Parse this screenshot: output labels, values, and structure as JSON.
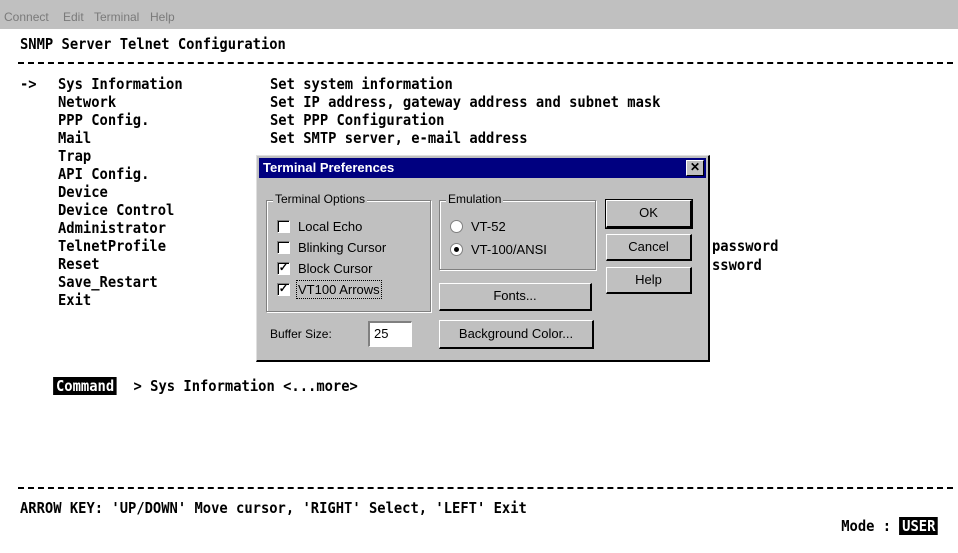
{
  "menubar": {
    "connect": "Connect",
    "edit": "Edit",
    "terminal": "Terminal",
    "help": "Help"
  },
  "terminal": {
    "header": "SNMP Server Telnet Configuration",
    "cursor_marker": "->",
    "menu": [
      {
        "name": "Sys Information",
        "desc": "Set system information"
      },
      {
        "name": "Network",
        "desc": "Set IP address, gateway address and subnet mask"
      },
      {
        "name": "PPP Config.",
        "desc": "Set PPP Configuration"
      },
      {
        "name": "Mail",
        "desc": "Set SMTP server, e-mail address"
      },
      {
        "name": "Trap",
        "desc": ""
      },
      {
        "name": "API Config.",
        "desc": ""
      },
      {
        "name": "Device",
        "desc": ""
      },
      {
        "name": "Device Control",
        "desc": ""
      },
      {
        "name": "Administrator",
        "desc": "password"
      },
      {
        "name": "TelnetProfile",
        "desc": "ssword"
      },
      {
        "name": "Reset",
        "desc": ""
      },
      {
        "name": "Save_Restart",
        "desc": ""
      },
      {
        "name": "Exit",
        "desc": ""
      }
    ],
    "command_label": "Command",
    "command_text": "> Sys Information <...more>",
    "footer_help": "ARROW KEY: 'UP/DOWN' Move cursor, 'RIGHT' Select, 'LEFT' Exit",
    "mode_label": "Mode :",
    "mode_value": "USER"
  },
  "dialog": {
    "title": "Terminal Preferences",
    "close_glyph": "✕",
    "terminal_options_label": "Terminal Options",
    "options": [
      {
        "label": "Local Echo",
        "checked": false
      },
      {
        "label": "Blinking Cursor",
        "checked": false
      },
      {
        "label": "Block Cursor",
        "checked": true
      },
      {
        "label": "VT100 Arrows",
        "checked": true
      }
    ],
    "emulation_label": "Emulation",
    "emulation": [
      {
        "label": "VT-52",
        "selected": false
      },
      {
        "label": "VT-100/ANSI",
        "selected": true
      }
    ],
    "ok_label": "OK",
    "cancel_label": "Cancel",
    "help_label": "Help",
    "fonts_label": "Fonts...",
    "bgcolor_label": "Background Color...",
    "buffer_size_label": "Buffer Size:",
    "buffer_size_value": "25"
  }
}
